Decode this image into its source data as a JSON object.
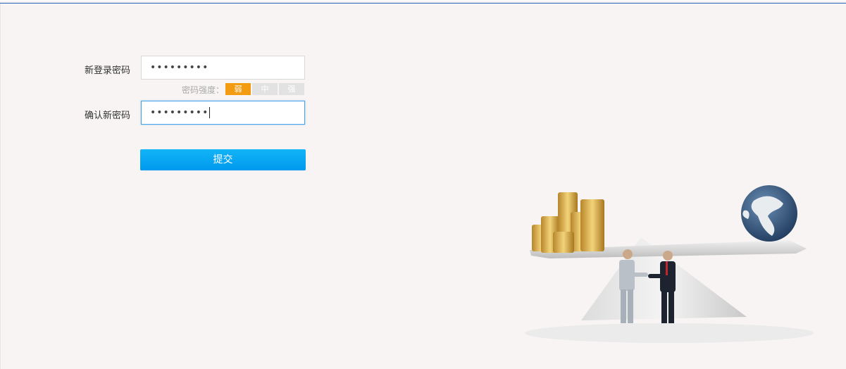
{
  "form": {
    "new_password_label": "新登录密码",
    "new_password_value": "•••••••••",
    "strength_label": "密码强度：",
    "strength_levels": [
      "弱",
      "中",
      "强"
    ],
    "strength_active": "弱",
    "confirm_password_label": "确认新密码",
    "confirm_password_value": "•••••••••",
    "submit_label": "提交"
  },
  "colors": {
    "accent": "#0aa3f2",
    "strength_active": "#f39c12",
    "strength_inactive": "#e2e2e2",
    "header_line": "#1f66b8"
  },
  "illustration": {
    "icon": "business-handshake-balance-illustration"
  }
}
